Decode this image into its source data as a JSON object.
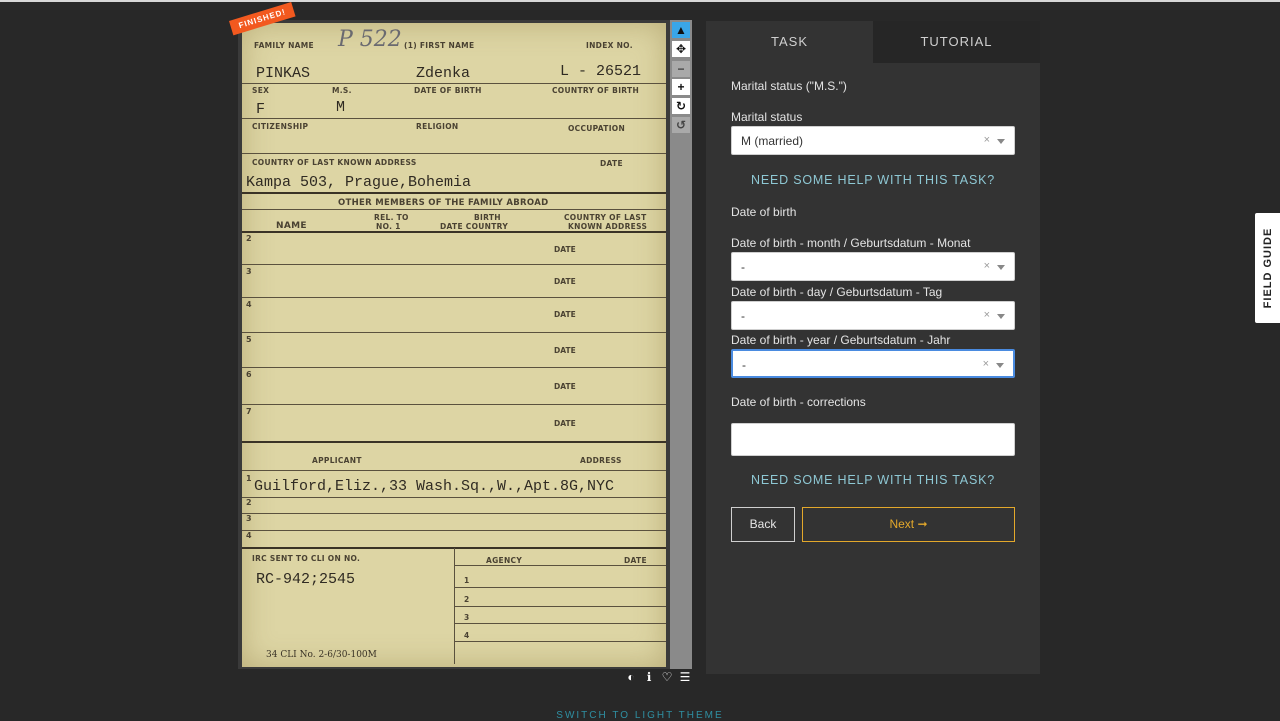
{
  "subject": {
    "finished_badge": "FINISHED!",
    "card": {
      "labels": {
        "family_name": "FAMILY NAME",
        "first_name": "(1) FIRST NAME",
        "index_no": "INDEX NO.",
        "sex": "SEX",
        "ms": "M.S.",
        "date_of_birth": "DATE OF BIRTH",
        "country_of_birth": "COUNTRY OF BIRTH",
        "citizenship": "CITIZENSHIP",
        "religion": "RELIGION",
        "occupation": "OCCUPATION",
        "country_last_address": "COUNTRY OF LAST KNOWN ADDRESS",
        "date": "DATE",
        "other_members": "OTHER MEMBERS OF THE FAMILY ABROAD",
        "name": "NAME",
        "rel_to": "REL. TO",
        "no1": "NO. 1",
        "birth": "BIRTH",
        "date_country": "DATE    COUNTRY",
        "country_last": "COUNTRY OF LAST",
        "known_address": "KNOWN ADDRESS",
        "applicant": "APPLICANT",
        "address": "ADDRESS",
        "irc_sent": "IRC SENT TO CLI ON NO.",
        "agency": "AGENCY",
        "footer": "34     CLI No. 2-6/30-100M"
      },
      "values": {
        "file_number": "P 522",
        "family_name": "PINKAS",
        "first_name": "Zdenka",
        "index_no": "L - 26521",
        "sex": "F",
        "ms": "M",
        "last_address": "Kampa 503, Prague,Bohemia",
        "applicant": "Guilford,Eliz.,33 Wash.Sq.,W.,Apt.8G,NYC",
        "irc_no": "RC-942;2545"
      },
      "row_numbers": [
        "2",
        "3",
        "4",
        "5",
        "6",
        "7"
      ],
      "applicant_rows": [
        "1",
        "2",
        "3",
        "4"
      ],
      "agency_rows": [
        "1",
        "2",
        "3",
        "4"
      ]
    },
    "tools": [
      "pointer-icon",
      "move-icon",
      "zoom-out-icon",
      "zoom-in-icon",
      "rotate-icon",
      "reset-icon"
    ],
    "tool_glyphs": [
      "▲",
      "✥",
      "−",
      "+",
      "↻",
      "↺"
    ],
    "viewer_icons": [
      "◐",
      "ℹ",
      "♡",
      "☰"
    ]
  },
  "panel": {
    "tabs": {
      "task": "TASK",
      "tutorial": "TUTORIAL"
    },
    "section_marital": "Marital status (\"M.S.\")",
    "marital_label": "Marital status",
    "marital_value": "M (married)",
    "help_text": "NEED SOME HELP WITH THIS TASK?",
    "section_dob": "Date of birth",
    "dob_month_label": "Date of birth - month / Geburtsdatum - Monat",
    "dob_month_value": "-",
    "dob_day_label": "Date of birth - day / Geburtsdatum - Tag",
    "dob_day_value": "-",
    "dob_year_label": "Date of birth - year / Geburtsdatum - Jahr",
    "dob_year_value": "-",
    "corrections_label": "Date of birth - corrections",
    "corrections_value": "",
    "clear_glyph": "×",
    "back": "Back",
    "next": "Next ➞"
  },
  "field_guide": "FIELD GUIDE",
  "switch_theme": "SWITCH TO LIGHT THEME",
  "colors": {
    "background": "#282828",
    "panel": "#333333",
    "accent_next": "#e3a82b",
    "help": "#8ec8d4",
    "finished": "#f2591f",
    "active_tool": "#3aa6e8"
  }
}
